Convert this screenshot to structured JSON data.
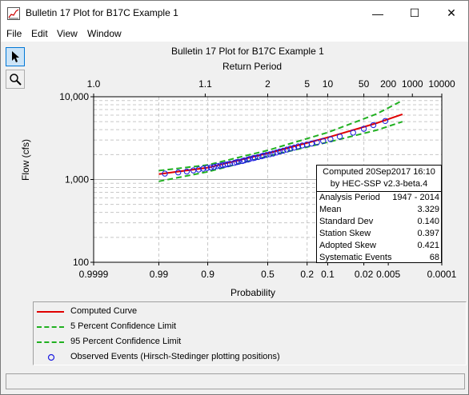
{
  "window": {
    "title": "Bulletin 17 Plot for B17C Example 1",
    "minimize_glyph": "—",
    "maximize_glyph": "☐",
    "close_glyph": "✕"
  },
  "menu": [
    "File",
    "Edit",
    "View",
    "Window"
  ],
  "tools": [
    {
      "name": "pointer-tool",
      "icon": "arrow-cursor-icon",
      "active": true
    },
    {
      "name": "zoom-tool",
      "icon": "magnifier-icon",
      "active": false
    }
  ],
  "plot": {
    "title": "Bulletin 17 Plot for B17C Example 1",
    "top_axis_label": "Return Period",
    "y_axis_label": "Flow (cfs)",
    "x_axis_label": "Probability"
  },
  "chart_data": {
    "type": "scatter",
    "x_scale": "normal-probability (exceedance, decreasing left to right)",
    "y_scale": "log",
    "ylim": [
      100,
      10000
    ],
    "xlim": [
      0.9999,
      0.0001
    ],
    "y_ticks": [
      "10,000",
      "1,000",
      "100"
    ],
    "x_ticks": [
      0.9999,
      0.99,
      0.9,
      0.5,
      0.2,
      0.1,
      0.02,
      0.005,
      0.0001
    ],
    "x_tick_labels": [
      "0.9999",
      "0.99",
      "0.9",
      "0.5",
      "0.2",
      "0.1",
      "0.02",
      "0.005",
      "0.0001"
    ],
    "top_ticks": [
      1.0,
      1.1,
      2,
      5,
      10,
      50,
      200,
      1000,
      10000
    ],
    "top_tick_labels": [
      "1.0",
      "1.1",
      "2",
      "5",
      "10",
      "50",
      "200",
      "1000",
      "10000"
    ],
    "series": [
      {
        "name": "Computed Curve",
        "kind": "line",
        "color": "#e00000",
        "style": "solid",
        "points": [
          [
            0.99,
            1160
          ],
          [
            0.9,
            1390
          ],
          [
            0.5,
            2070
          ],
          [
            0.1,
            3220
          ],
          [
            0.01,
            4800
          ],
          [
            0.002,
            6150
          ]
        ]
      },
      {
        "name": "5 Percent Confidence Limit",
        "kind": "line",
        "color": "#20b020",
        "style": "dashed",
        "points": [
          [
            0.99,
            1280
          ],
          [
            0.9,
            1500
          ],
          [
            0.5,
            2250
          ],
          [
            0.1,
            3700
          ],
          [
            0.01,
            6200
          ],
          [
            0.002,
            9000
          ]
        ]
      },
      {
        "name": "95 Percent Confidence Limit",
        "kind": "line",
        "color": "#20b020",
        "style": "dashed",
        "points": [
          [
            0.99,
            950
          ],
          [
            0.9,
            1240
          ],
          [
            0.5,
            1910
          ],
          [
            0.1,
            2820
          ],
          [
            0.01,
            3950
          ],
          [
            0.002,
            5000
          ]
        ]
      },
      {
        "name": "Observed Events (Hirsch-Stedinger plotting positions)",
        "kind": "scatter",
        "color": "#1a1ae0",
        "marker": "open-circle",
        "points": [
          [
            0.986,
            1180
          ],
          [
            0.972,
            1220
          ],
          [
            0.958,
            1250
          ],
          [
            0.944,
            1290
          ],
          [
            0.93,
            1320
          ],
          [
            0.916,
            1350
          ],
          [
            0.902,
            1380
          ],
          [
            0.888,
            1400
          ],
          [
            0.874,
            1420
          ],
          [
            0.86,
            1450
          ],
          [
            0.846,
            1470
          ],
          [
            0.832,
            1490
          ],
          [
            0.818,
            1510
          ],
          [
            0.804,
            1530
          ],
          [
            0.79,
            1550
          ],
          [
            0.762,
            1590
          ],
          [
            0.748,
            1620
          ],
          [
            0.734,
            1640
          ],
          [
            0.706,
            1670
          ],
          [
            0.692,
            1700
          ],
          [
            0.664,
            1740
          ],
          [
            0.65,
            1770
          ],
          [
            0.622,
            1810
          ],
          [
            0.608,
            1830
          ],
          [
            0.58,
            1870
          ],
          [
            0.552,
            1910
          ],
          [
            0.538,
            1940
          ],
          [
            0.51,
            1980
          ],
          [
            0.482,
            2020
          ],
          [
            0.454,
            2060
          ],
          [
            0.426,
            2120
          ],
          [
            0.398,
            2180
          ],
          [
            0.37,
            2230
          ],
          [
            0.342,
            2300
          ],
          [
            0.314,
            2370
          ],
          [
            0.286,
            2430
          ],
          [
            0.258,
            2510
          ],
          [
            0.23,
            2580
          ],
          [
            0.202,
            2650
          ],
          [
            0.174,
            2720
          ],
          [
            0.146,
            2810
          ],
          [
            0.118,
            2920
          ],
          [
            0.09,
            3070
          ],
          [
            0.062,
            3300
          ],
          [
            0.034,
            3680
          ],
          [
            0.02,
            4100
          ],
          [
            0.012,
            4550
          ],
          [
            0.006,
            5100
          ]
        ]
      }
    ]
  },
  "stats": {
    "header1": "Computed 20Sep2017 16:10",
    "header2": "by HEC-SSP v2.3-beta.4",
    "rows": [
      {
        "k": "Analysis Period",
        "v": "1947 - 2014"
      },
      {
        "k": "Mean",
        "v": "3.329"
      },
      {
        "k": "Standard Dev",
        "v": "0.140"
      },
      {
        "k": "Station Skew",
        "v": "0.397"
      },
      {
        "k": "Adopted Skew",
        "v": "0.421"
      },
      {
        "k": "Systematic Events",
        "v": "68"
      }
    ]
  },
  "legend": [
    {
      "label": "Computed Curve",
      "color": "#e00000",
      "kind": "solid"
    },
    {
      "label": "5 Percent Confidence Limit",
      "color": "#20b020",
      "kind": "dashed"
    },
    {
      "label": "95 Percent Confidence Limit",
      "color": "#20b020",
      "kind": "dashed"
    },
    {
      "label": "Observed Events (Hirsch-Stedinger plotting positions)",
      "color": "#1a1ae0",
      "kind": "circle"
    }
  ]
}
